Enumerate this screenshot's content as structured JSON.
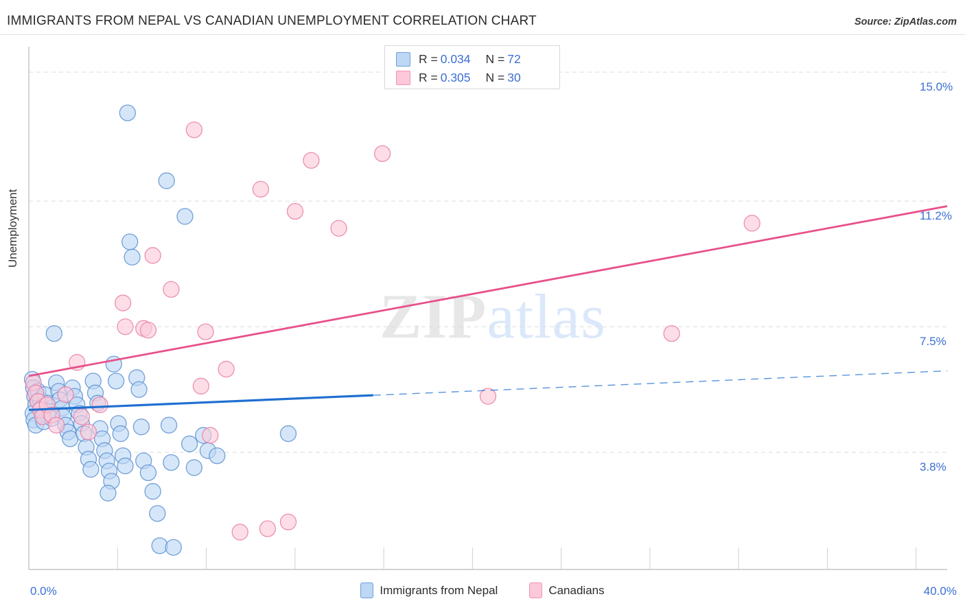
{
  "header": {
    "title": "IMMIGRANTS FROM NEPAL VS CANADIAN UNEMPLOYMENT CORRELATION CHART",
    "source": "Source: ZipAtlas.com"
  },
  "watermark": {
    "part1": "ZIP",
    "part2": "atlas"
  },
  "legend": {
    "rows": [
      {
        "series": "Immigrants from Nepal",
        "r_label": "R =",
        "r_value": "0.034",
        "n_label": "N =",
        "n_value": "72",
        "color": "#bdd7f5"
      },
      {
        "series": "Canadians",
        "r_label": "R =",
        "r_value": "0.305",
        "n_label": "N =",
        "n_value": "30",
        "color": "#fbc9d9"
      }
    ]
  },
  "bottom_legend": {
    "items": [
      {
        "label": "Immigrants from Nepal",
        "color": "#bdd7f5"
      },
      {
        "label": "Canadians",
        "color": "#fbc9d9"
      }
    ]
  },
  "axes": {
    "ylabel": "Unemployment",
    "yticks": [
      "15.0%",
      "11.2%",
      "7.5%",
      "3.8%"
    ],
    "ytick_values": [
      15.0,
      11.2,
      7.5,
      3.8
    ],
    "xticks": [
      "0.0%",
      "40.0%"
    ],
    "xtick_values": [
      0.0,
      40.0
    ]
  },
  "chart_data": {
    "type": "scatter",
    "title": "IMMIGRANTS FROM NEPAL VS CANADIAN UNEMPLOYMENT CORRELATION CHART",
    "xlabel": "Immigrants from Nepal",
    "ylabel": "Unemployment",
    "xlim": [
      0.0,
      40.0
    ],
    "ylim": [
      0.35,
      15.75
    ],
    "grid": true,
    "gridlines_y": [
      15.0,
      11.2,
      7.5,
      3.8
    ],
    "legend_position": "top-center",
    "series": [
      {
        "name": "Immigrants from Nepal",
        "color": "#bdd7f5",
        "edge_color": "#5b90d0",
        "R": 0.034,
        "N": 72,
        "trend": {
          "x0": 0.0,
          "y0": 5.05,
          "x1": 40.0,
          "y1": 6.2,
          "solid_until_x": 15.0
        },
        "points": [
          [
            0.15,
            5.95
          ],
          [
            0.2,
            5.7
          ],
          [
            0.25,
            5.45
          ],
          [
            0.3,
            5.2
          ],
          [
            0.18,
            4.95
          ],
          [
            0.22,
            4.75
          ],
          [
            0.3,
            4.6
          ],
          [
            0.4,
            5.6
          ],
          [
            0.5,
            5.35
          ],
          [
            0.55,
            5.1
          ],
          [
            0.6,
            4.9
          ],
          [
            0.65,
            4.7
          ],
          [
            0.7,
            5.5
          ],
          [
            0.8,
            5.25
          ],
          [
            0.9,
            5.0
          ],
          [
            1.0,
            4.8
          ],
          [
            1.1,
            7.3
          ],
          [
            1.2,
            5.85
          ],
          [
            1.3,
            5.6
          ],
          [
            1.35,
            5.35
          ],
          [
            1.45,
            5.1
          ],
          [
            1.5,
            4.85
          ],
          [
            1.6,
            4.6
          ],
          [
            1.7,
            4.4
          ],
          [
            1.8,
            4.2
          ],
          [
            1.9,
            5.7
          ],
          [
            2.0,
            5.45
          ],
          [
            2.1,
            5.2
          ],
          [
            2.2,
            4.95
          ],
          [
            2.3,
            4.65
          ],
          [
            2.4,
            4.35
          ],
          [
            2.5,
            3.95
          ],
          [
            2.6,
            3.6
          ],
          [
            2.7,
            3.3
          ],
          [
            2.8,
            5.9
          ],
          [
            2.9,
            5.55
          ],
          [
            3.0,
            5.25
          ],
          [
            3.1,
            4.5
          ],
          [
            3.2,
            4.2
          ],
          [
            3.3,
            3.85
          ],
          [
            3.4,
            3.55
          ],
          [
            3.5,
            3.25
          ],
          [
            3.6,
            2.95
          ],
          [
            3.7,
            6.4
          ],
          [
            3.8,
            5.9
          ],
          [
            3.9,
            4.65
          ],
          [
            4.0,
            4.35
          ],
          [
            4.1,
            3.7
          ],
          [
            4.2,
            3.4
          ],
          [
            4.3,
            13.8
          ],
          [
            4.4,
            10.0
          ],
          [
            4.5,
            9.55
          ],
          [
            4.7,
            6.0
          ],
          [
            4.8,
            5.65
          ],
          [
            4.9,
            4.55
          ],
          [
            5.0,
            3.55
          ],
          [
            5.2,
            3.2
          ],
          [
            5.4,
            2.65
          ],
          [
            5.6,
            2.0
          ],
          [
            5.7,
            1.05
          ],
          [
            6.0,
            11.8
          ],
          [
            6.1,
            4.6
          ],
          [
            6.2,
            3.5
          ],
          [
            6.3,
            1.0
          ],
          [
            6.8,
            10.75
          ],
          [
            7.0,
            4.05
          ],
          [
            7.2,
            3.35
          ],
          [
            7.6,
            4.3
          ],
          [
            7.8,
            3.85
          ],
          [
            8.2,
            3.7
          ],
          [
            11.3,
            4.35
          ],
          [
            3.45,
            2.6
          ]
        ]
      },
      {
        "name": "Canadians",
        "color": "#fbc9d9",
        "edge_color": "#e87ea4",
        "R": 0.305,
        "N": 30,
        "trend": {
          "x0": 0.0,
          "y0": 6.05,
          "x1": 40.0,
          "y1": 11.05,
          "solid_until_x": 40.0
        },
        "points": [
          [
            0.2,
            5.85
          ],
          [
            0.3,
            5.55
          ],
          [
            0.4,
            5.3
          ],
          [
            0.5,
            5.05
          ],
          [
            0.6,
            4.85
          ],
          [
            0.8,
            5.2
          ],
          [
            1.0,
            4.9
          ],
          [
            1.2,
            4.6
          ],
          [
            1.6,
            5.5
          ],
          [
            2.1,
            6.45
          ],
          [
            2.3,
            4.85
          ],
          [
            2.6,
            4.4
          ],
          [
            3.1,
            5.2
          ],
          [
            4.1,
            8.2
          ],
          [
            4.2,
            7.5
          ],
          [
            5.0,
            7.45
          ],
          [
            5.2,
            7.4
          ],
          [
            5.4,
            9.6
          ],
          [
            6.2,
            8.6
          ],
          [
            7.2,
            13.3
          ],
          [
            7.5,
            5.75
          ],
          [
            7.7,
            7.35
          ],
          [
            7.9,
            4.3
          ],
          [
            8.6,
            6.25
          ],
          [
            9.2,
            1.45
          ],
          [
            10.1,
            11.55
          ],
          [
            10.4,
            1.55
          ],
          [
            11.3,
            1.75
          ],
          [
            11.6,
            10.9
          ],
          [
            12.3,
            12.4
          ],
          [
            13.5,
            10.4
          ],
          [
            15.4,
            12.6
          ],
          [
            20.0,
            5.45
          ],
          [
            28.0,
            7.3
          ],
          [
            31.5,
            10.55
          ]
        ]
      }
    ]
  }
}
